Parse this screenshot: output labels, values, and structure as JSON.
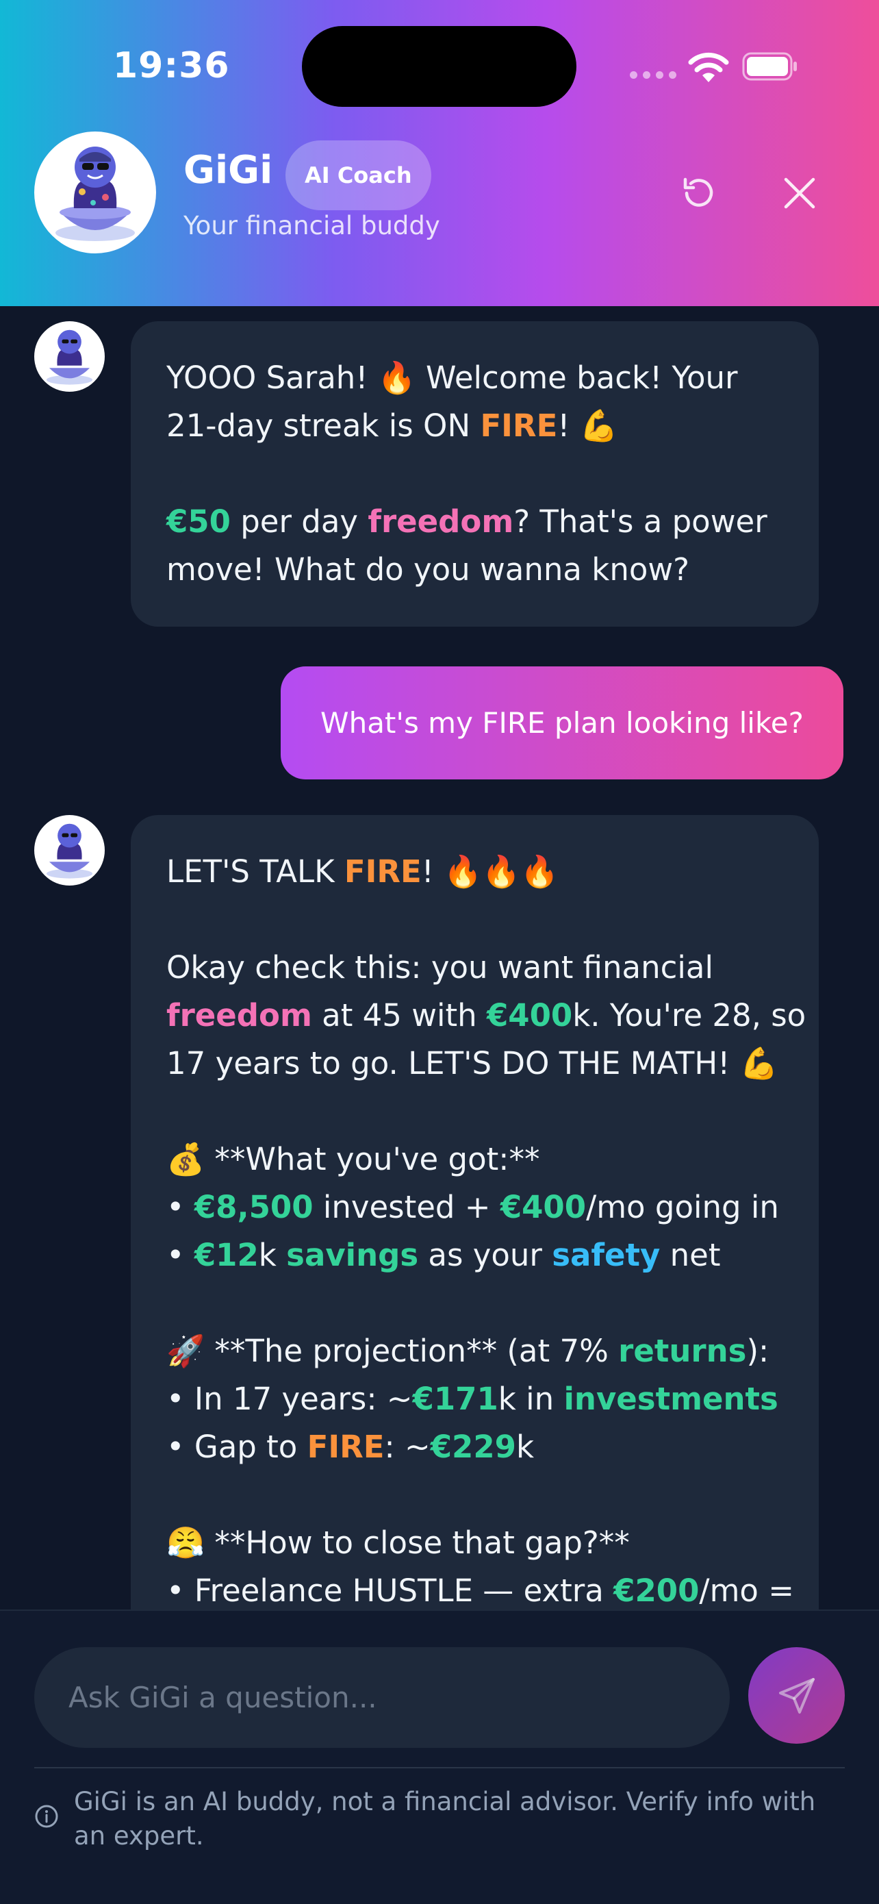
{
  "status_bar": {
    "time": "19:36"
  },
  "header": {
    "name": "GiGi",
    "badge": "AI Coach",
    "subtitle": "Your financial buddy",
    "icons": {
      "avatar": "genie-avatar",
      "reset": "refresh-icon",
      "close": "close-icon"
    }
  },
  "messages": [
    {
      "role": "assistant",
      "lines": [
        [
          {
            "t": "YOOO Sarah! 🔥 Welcome back! Your"
          }
        ],
        [
          {
            "t": "21-day streak is ON "
          },
          {
            "t": "FIRE",
            "c": "o"
          },
          {
            "t": "! 💪"
          }
        ],
        [],
        [
          {
            "t": "€50",
            "c": "g"
          },
          {
            "t": " per day "
          },
          {
            "t": "freedom",
            "c": "p"
          },
          {
            "t": "? That's a power"
          }
        ],
        [
          {
            "t": "move! What do you wanna know?"
          }
        ]
      ]
    },
    {
      "role": "user",
      "text": "What's my FIRE plan looking like?"
    },
    {
      "role": "assistant",
      "lines": [
        [
          {
            "t": "LET'S TALK "
          },
          {
            "t": "FIRE",
            "c": "o"
          },
          {
            "t": "! 🔥🔥🔥"
          }
        ],
        [],
        [
          {
            "t": "Okay check this: you want financial"
          }
        ],
        [
          {
            "t": "freedom",
            "c": "p"
          },
          {
            "t": " at 45 with "
          },
          {
            "t": "€400",
            "c": "g"
          },
          {
            "t": "k. You're 28, so"
          }
        ],
        [
          {
            "t": "17 years to go. LET'S DO THE MATH! 💪"
          }
        ],
        [],
        [
          {
            "t": "💰 **What you've got:**"
          }
        ],
        [
          {
            "t": "• "
          },
          {
            "t": "€8,500",
            "c": "g"
          },
          {
            "t": " invested + "
          },
          {
            "t": "€400",
            "c": "g"
          },
          {
            "t": "/mo going in"
          }
        ],
        [
          {
            "t": "• "
          },
          {
            "t": "€12",
            "c": "g"
          },
          {
            "t": "k "
          },
          {
            "t": "savings",
            "c": "g"
          },
          {
            "t": " as your "
          },
          {
            "t": "safety",
            "c": "b"
          },
          {
            "t": " net"
          }
        ],
        [],
        [
          {
            "t": "🚀 **The projection** (at 7% "
          },
          {
            "t": "returns",
            "c": "g"
          },
          {
            "t": "):"
          }
        ],
        [
          {
            "t": "• In 17 years: ~"
          },
          {
            "t": "€171",
            "c": "g"
          },
          {
            "t": "k in "
          },
          {
            "t": "investments",
            "c": "g"
          }
        ],
        [
          {
            "t": "• Gap to "
          },
          {
            "t": "FIRE",
            "c": "o"
          },
          {
            "t": ": ~"
          },
          {
            "t": "€229",
            "c": "g"
          },
          {
            "t": "k"
          }
        ],
        [],
        [
          {
            "t": "😤 **How to close that gap?**"
          }
        ],
        [
          {
            "t": "• Freelance HUSTLE — extra "
          },
          {
            "t": "€200",
            "c": "g"
          },
          {
            "t": "/mo ="
          }
        ]
      ]
    }
  ],
  "composer": {
    "placeholder": "Ask GiGi a question...",
    "send_icon": "send-icon"
  },
  "disclaimer": "GiGi is an AI buddy, not a financial advisor. Verify info with an expert.",
  "colors": {
    "gradient": [
      "#12b8d6",
      "#b64cec",
      "#ee4e9b"
    ],
    "background": "#0f1729",
    "bubble": "#1e293b",
    "money": "#34d399",
    "freedom": "#f472b6",
    "fire": "#fb923c",
    "safety": "#38bdf8"
  }
}
